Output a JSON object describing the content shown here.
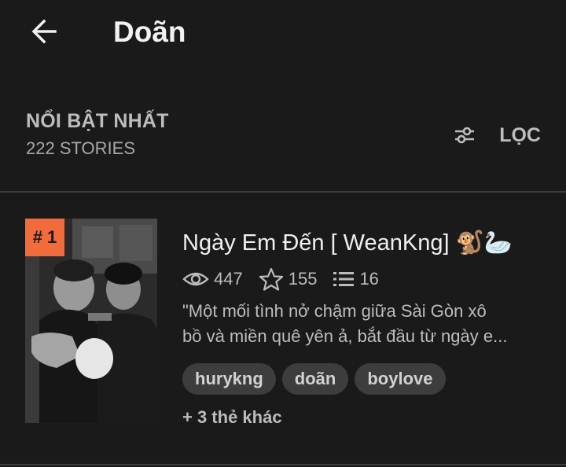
{
  "header": {
    "title": "Doãn",
    "back_icon": "arrow-left-icon"
  },
  "section": {
    "sort_label": "NỔI BẬT NHẤT",
    "count_label": "222 STORIES",
    "filter_label": "LỌC",
    "filter_icon": "sliders-icon"
  },
  "story": {
    "rank": "# 1",
    "title": "Ngày Em Đến [ WeanKng] 🐒🦢",
    "stats": {
      "reads": "447",
      "votes": "155",
      "parts": "16"
    },
    "description_lines": [
      "\"Một mối tình nở chậm giữa Sài Gòn xô",
      "bồ và miền quê yên ả, bắt đầu từ ngày e..."
    ],
    "tags": [
      "hurykng",
      "doãn",
      "boylove"
    ],
    "more_tags": "+ 3 thẻ khác"
  },
  "colors": {
    "background": "#1a1a1a",
    "accent": "#f26b3a",
    "tag_bg": "#3d3d3d"
  }
}
